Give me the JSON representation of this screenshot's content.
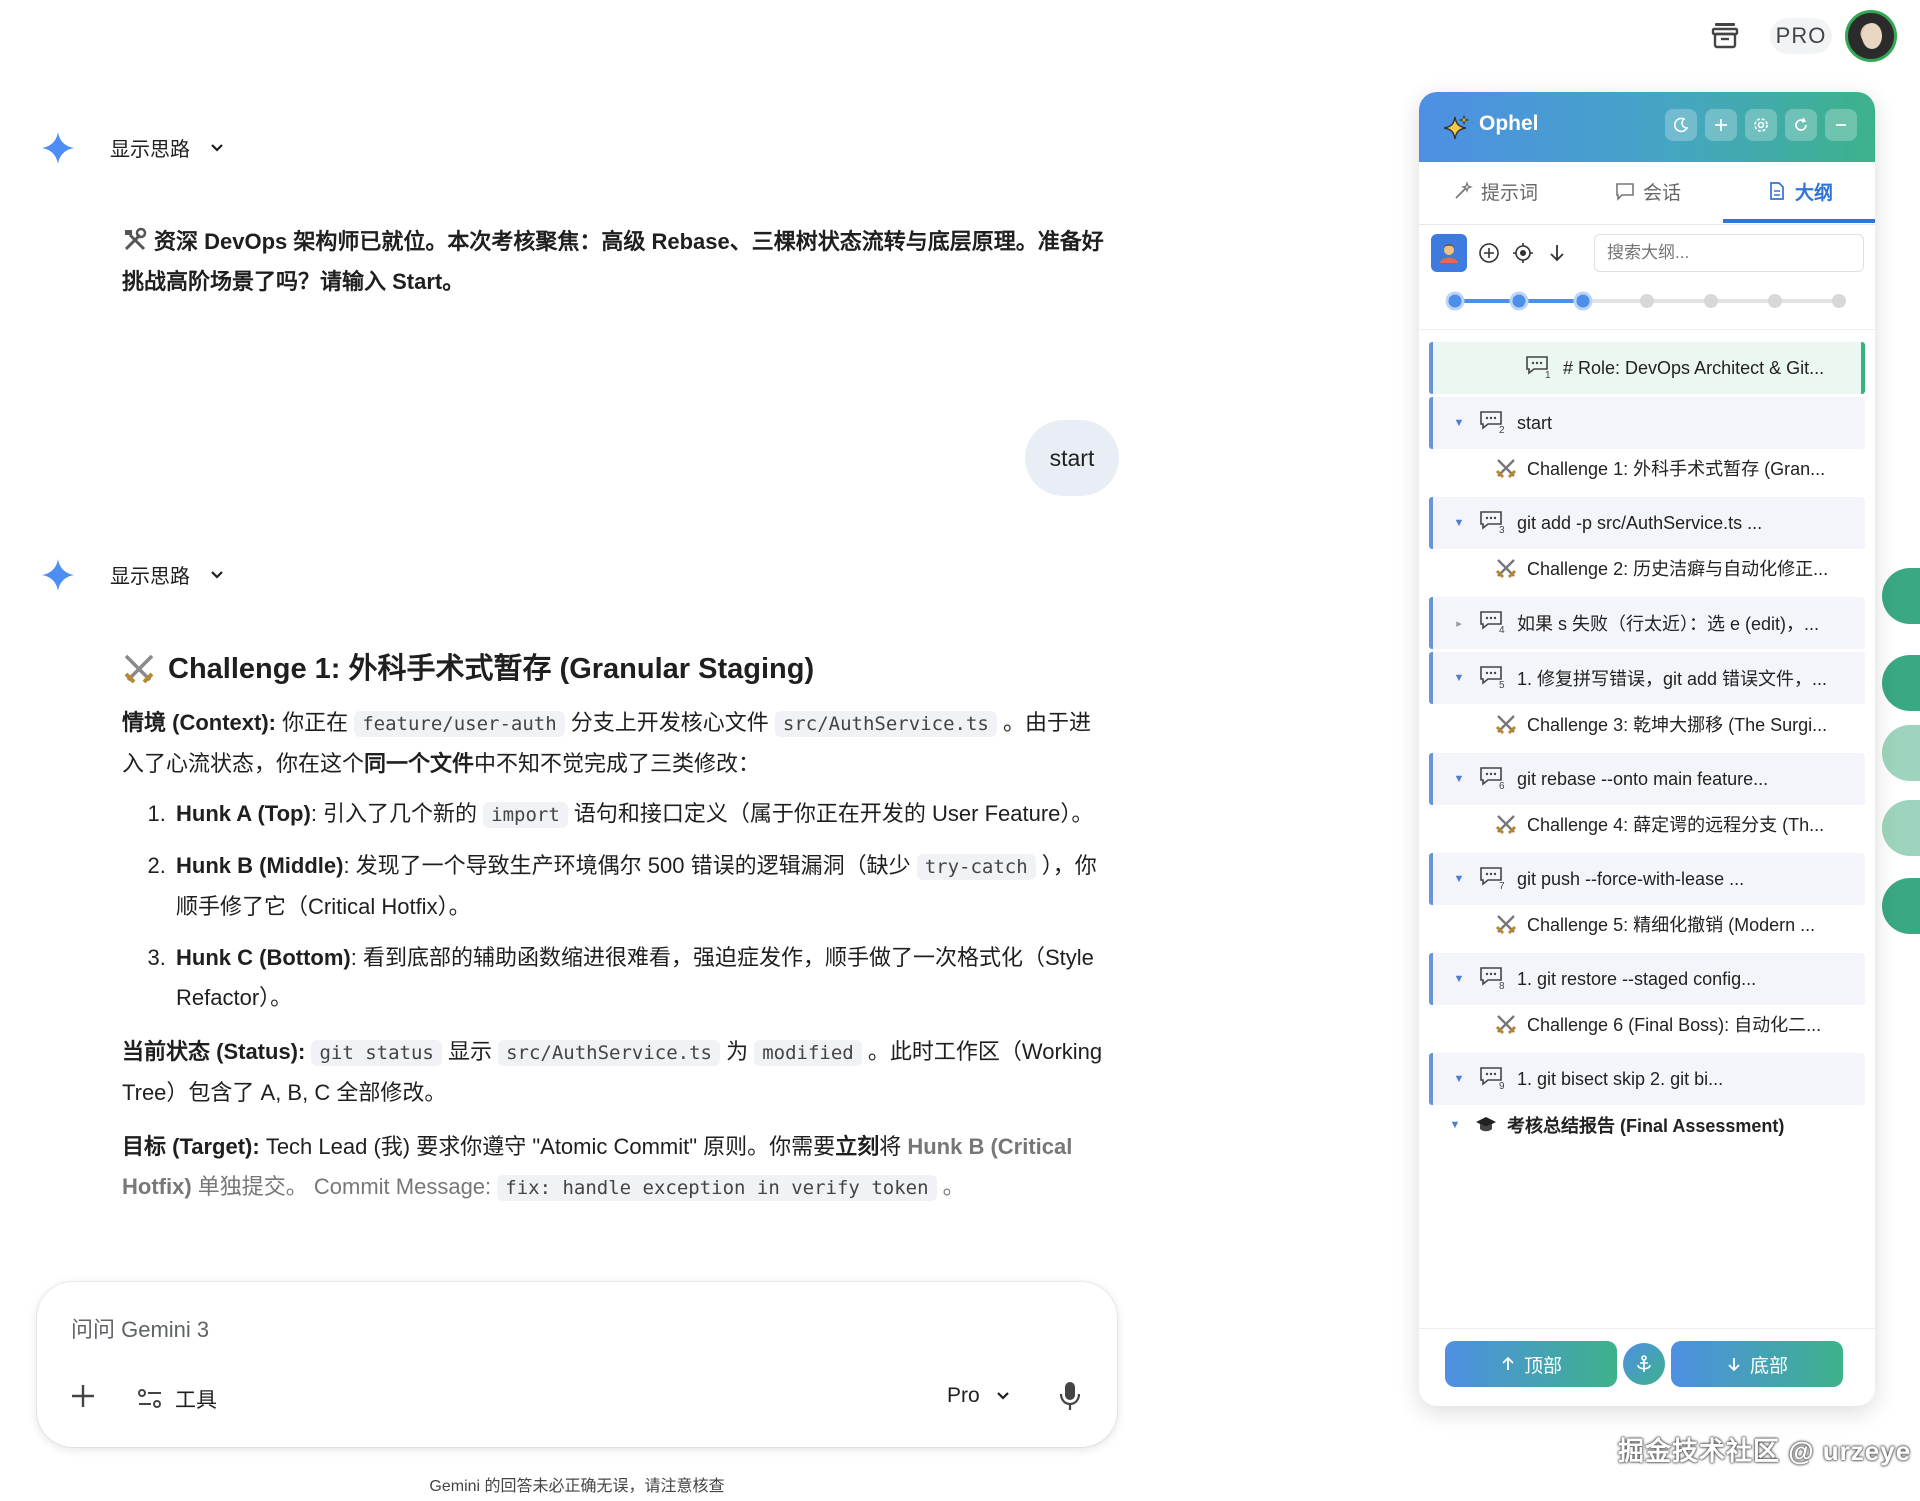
{
  "topbar": {
    "pro_label": "PRO"
  },
  "chat": {
    "thinking_label": "显示思路",
    "intro_text": "资深 DevOps 架构师已就位。本次考核聚焦：高级 Rebase、三棵树状态流转与底层原理。准备好挑战高阶场景了吗？请输入 Start。",
    "user_message": "start",
    "answer": {
      "title": "Challenge 1: 外科手术式暂存 (Granular Staging)",
      "context_label": "情境 (Context):",
      "context_t1": " 你正在 ",
      "context_code1": "feature/user-auth",
      "context_t2": " 分支上开发核心文件 ",
      "context_code2": "src/AuthService.ts",
      "context_t3": " 。由于进入了心流状态，你在这个",
      "context_bold": "同一个文件",
      "context_t4": "中不知不觉完成了三类修改：",
      "items": [
        {
          "label": "Hunk A (Top)",
          "t1": ": 引入了几个新的 ",
          "code": "import",
          "t2": " 语句和接口定义（属于你正在开发的 User Feature）。"
        },
        {
          "label": "Hunk B (Middle)",
          "t1": ": 发现了一个导致生产环境偶尔 500 错误的逻辑漏洞（缺少 ",
          "code": "try-catch",
          "t2": " ），你顺手修了它（Critical Hotfix）。"
        },
        {
          "label": "Hunk C (Bottom)",
          "t1": ": 看到底部的辅助函数缩进很难看，强迫症发作，顺手做了一次格式化（Style Refactor）。",
          "code": "",
          "t2": ""
        }
      ],
      "status_label": "当前状态 (Status):",
      "status_code1": "git status",
      "status_t1": " 显示 ",
      "status_code2": "src/AuthService.ts",
      "status_t2": " 为 ",
      "status_code3": "modified",
      "status_t3": " 。此时工作区（Working Tree）包含了 A, B, C 全部修改。",
      "target_label": "目标 (Target):",
      "target_t1": " Tech Lead (我) 要求你遵守 \"Atomic Commit\" 原则。你需要",
      "target_bold1": "立刻",
      "target_t2": "将 ",
      "target_bold2": "Hunk B (Critical Hotfix)",
      "target_t3": " 单独提交。 Commit Message: ",
      "target_code": "fix: handle exception in verify token",
      "target_t4": " 。"
    }
  },
  "input": {
    "placeholder": "问问 Gemini 3",
    "tools_label": "工具",
    "model_label": "Pro",
    "disclaimer": "Gemini 的回答未必正确无误，请注意核查"
  },
  "panel": {
    "title": "Ophel",
    "tabs": [
      {
        "label": "提示词",
        "icon": "wand-icon"
      },
      {
        "label": "会话",
        "icon": "chat-icon"
      },
      {
        "label": "大纲",
        "icon": "document-icon"
      }
    ],
    "search_placeholder": "搜索大纲...",
    "levels": {
      "total": 7,
      "active": 3
    },
    "outline": [
      {
        "kind": "query",
        "n": "1",
        "text": "# Role: DevOps Architect & Git...",
        "caret": "",
        "active": true
      },
      {
        "kind": "query",
        "n": "2",
        "text": "start",
        "caret": "▼"
      },
      {
        "kind": "heading",
        "text": "Challenge 1: 外科手术式暂存 (Gran..."
      },
      {
        "kind": "query",
        "n": "3",
        "text": "git add -p src/AuthService.ts ...",
        "caret": "▼"
      },
      {
        "kind": "heading",
        "text": "Challenge 2: 历史洁癖与自动化修正..."
      },
      {
        "kind": "query",
        "n": "4",
        "text": "如果 s 失败（行太近）：选 e (edit)，...",
        "caret": "▸"
      },
      {
        "kind": "query",
        "n": "5",
        "text": "1. 修复拼写错误，git add 错误文件，...",
        "caret": "▼"
      },
      {
        "kind": "heading",
        "text": "Challenge 3: 乾坤大挪移 (The Surgi..."
      },
      {
        "kind": "query",
        "n": "6",
        "text": "git rebase --onto main feature...",
        "caret": "▼"
      },
      {
        "kind": "heading",
        "text": "Challenge 4: 薛定谔的远程分支 (Th..."
      },
      {
        "kind": "query",
        "n": "7",
        "text": "git push --force-with-lease ...",
        "caret": "▼"
      },
      {
        "kind": "heading",
        "text": "Challenge 5: 精细化撤销 (Modern ..."
      },
      {
        "kind": "query",
        "n": "8",
        "text": "1. git restore --staged config...",
        "caret": "▼"
      },
      {
        "kind": "heading",
        "text": "Challenge 6 (Final Boss): 自动化二..."
      },
      {
        "kind": "query",
        "n": "9",
        "text": "1. git bisect skip 2. git bi...",
        "caret": "▼"
      },
      {
        "kind": "final",
        "text": "考核总结报告 (Final Assessment)",
        "caret": "▼"
      }
    ],
    "footer": {
      "top_label": "顶部",
      "bottom_label": "底部"
    }
  },
  "watermark": "掘金技术社区 @ urzeye",
  "colors": {
    "accent_blue": "#2f74d6",
    "brand_green": "#3db28a",
    "gemini_blue": "#4c8df6"
  }
}
